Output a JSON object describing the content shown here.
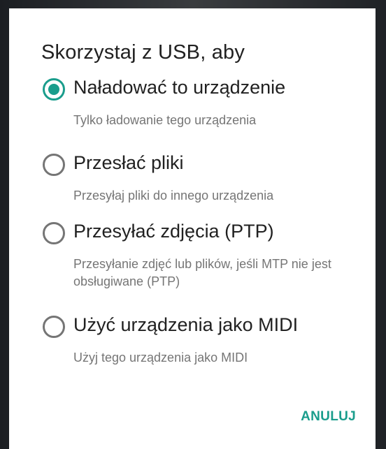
{
  "dialog": {
    "title": "Skorzystaj z USB, aby",
    "options": [
      {
        "label": "Naładować to urządzenie",
        "description": "Tylko ładowanie tego urządzenia",
        "selected": true
      },
      {
        "label": "Przesłać pliki",
        "description": "Przesyłaj pliki do innego urządzenia",
        "selected": false
      },
      {
        "label": "Przesyłać zdjęcia (PTP)",
        "description": "Przesyłanie zdjęć lub plików, jeśli MTP nie jest obsługiwane (PTP)",
        "selected": false
      },
      {
        "label": "Użyć urządzenia jako MIDI",
        "description": "Użyj tego urządzenia jako MIDI",
        "selected": false
      }
    ],
    "cancel_label": "ANULUJ"
  },
  "colors": {
    "accent": "#1a9d8c",
    "radio_unchecked": "#757575",
    "text_primary": "#212121",
    "text_secondary": "#757575",
    "dialog_background": "#ffffff"
  },
  "icons": {
    "radio_checked": "radio-checked-icon",
    "radio_unchecked": "radio-unchecked-icon"
  }
}
